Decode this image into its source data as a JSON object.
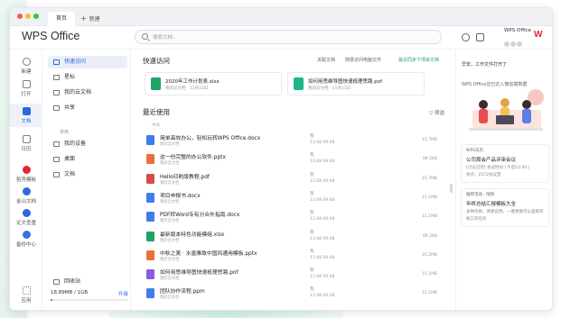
{
  "titlebar": {
    "tab_home": "首页",
    "tab_new": "新建"
  },
  "header": {
    "brand": "WPS Office",
    "search_placeholder": "搜索文档...",
    "account_name": "WPS Office"
  },
  "icon_nav": [
    {
      "label": "新建",
      "icon": "plus-circle-icon",
      "color": "#7b7f86"
    },
    {
      "label": "打开",
      "icon": "folder-open-icon",
      "color": "#7b7f86"
    },
    {
      "label": "文档",
      "icon": "document-icon",
      "color": "#2a6ae0"
    },
    {
      "label": "日历",
      "icon": "calendar-icon",
      "color": "#7b7f86"
    },
    {
      "label": "稻壳模板",
      "icon": "docer-template-icon",
      "color": "#e0282e"
    },
    {
      "label": "金山文档",
      "icon": "kdocs-icon",
      "color": "#2a6ae0"
    },
    {
      "label": "论文查重",
      "icon": "paper-check-icon",
      "color": "#2a6ae0"
    },
    {
      "label": "备份中心",
      "icon": "backup-icon",
      "color": "#3b6fe0"
    },
    {
      "label": "应用",
      "icon": "apps-grid-icon",
      "color": "#7b7f86"
    }
  ],
  "sidebar": {
    "items": [
      {
        "label": "快速访问"
      },
      {
        "label": "星标"
      },
      {
        "label": "我的云文档"
      },
      {
        "label": "共享"
      }
    ],
    "section_label": "常用",
    "section_items": [
      {
        "label": "我的设备"
      },
      {
        "label": "桌面"
      },
      {
        "label": "文档"
      }
    ],
    "trash_label": "回收站",
    "storage": {
      "used": "18.89MB / 1GB",
      "upgrade": "升级",
      "fraction": 0.02
    }
  },
  "main": {
    "quick_access_title": "快速访问",
    "tool_fwd": "关联文档",
    "tool_sync": "随录访问电脑文件",
    "tool_add": "最近同步下项目文档",
    "quick_cards": [
      {
        "name": "2020年工作计划表.xlsx",
        "sub": "我的云文档 · 11月15日",
        "type": "xlsx",
        "color": "#1fa463"
      },
      {
        "name": "如何用思维导图快速梳理思路.pof",
        "sub": "我的云文档 · 11月15日",
        "type": "pof",
        "color": "#1fb58a"
      }
    ],
    "recent_title": "最近使用",
    "filter_label": "筛选",
    "list_head": "今天",
    "files": [
      {
        "name": "简单高效办公，轻松玩转WPS Office.docx",
        "sub": "我的云文档",
        "who": "我",
        "when": "11:08 09:48",
        "size": "15.7MB",
        "color": "#3f7ee8"
      },
      {
        "name": "这一份完整的办公软件.pptx",
        "sub": "我的云文档",
        "who": "我",
        "when": "11:08 09:48",
        "size": "89.2KB",
        "color": "#e8703a"
      },
      {
        "name": "Hello印刷版教程.pdf",
        "sub": "我的云文档",
        "who": "我",
        "when": "11:08 09:48",
        "size": "15.7MB",
        "color": "#d94a4a"
      },
      {
        "name": "项目申报书.docx",
        "sub": "我的云文档",
        "who": "我",
        "when": "11:08 09:48",
        "size": "15.1MB",
        "color": "#3f7ee8"
      },
      {
        "name": "PDF转Word专有分合外指南.docx",
        "sub": "我的云文档",
        "who": "我",
        "when": "11:08 09:48",
        "size": "15.1MB",
        "color": "#3f7ee8"
      },
      {
        "name": "最新版本特色功能模组.xlsx",
        "sub": "我的云文档",
        "who": "我",
        "when": "11:08 09:48",
        "size": "89.2KB",
        "color": "#1fa463"
      },
      {
        "name": "中秋之美 · 水墨雅致中国风通用模板.pptx",
        "sub": "我的云文档",
        "who": "我",
        "when": "11:08 09:48",
        "size": "20.2MB",
        "color": "#e8703a"
      },
      {
        "name": "如何用思维导图快速梳理思路.pof",
        "sub": "我的云文档",
        "who": "我",
        "when": "11:08 09:48",
        "size": "15.1MB",
        "color": "#8a5ce0"
      },
      {
        "name": "团队协作流程.ppm",
        "sub": "我的云文档",
        "who": "我",
        "when": "11:08 09:48",
        "size": "15.1MB",
        "color": "#3f7ee8"
      }
    ]
  },
  "right_panel": {
    "top_label": "早安，工作文件打开了",
    "banner_caption": "WPS Office应已达入微信端数据",
    "card1": {
      "caption": "WPS日历",
      "title": "公司周会产品评审会议",
      "line1": "[讨论已完] 会议时间 | 午后12:00 |",
      "line2": "地点：2572会议室"
    },
    "card2": {
      "caption": "推荐活动 · 限购",
      "title": "年终总结汇报模板大全",
      "line1": "多种风格，简易说明，一键更换可以直接开",
      "line2": "始工作任务"
    }
  }
}
